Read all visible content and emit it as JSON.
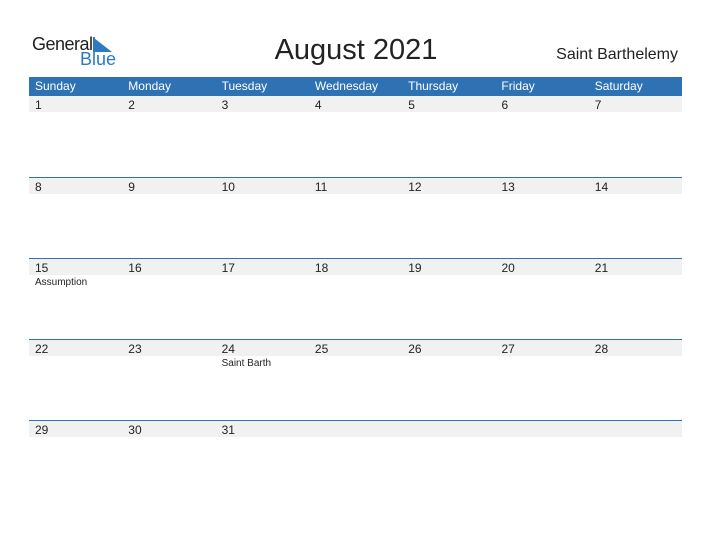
{
  "logo": {
    "general": "General",
    "blue": "Blue"
  },
  "title": "August 2021",
  "country": "Saint Barthelemy",
  "colors": {
    "accent": "#2e72b4",
    "band": "#f1f1f1"
  },
  "weekdays": [
    "Sunday",
    "Monday",
    "Tuesday",
    "Wednesday",
    "Thursday",
    "Friday",
    "Saturday"
  ],
  "weeks": [
    [
      {
        "day": "1"
      },
      {
        "day": "2"
      },
      {
        "day": "3"
      },
      {
        "day": "4"
      },
      {
        "day": "5"
      },
      {
        "day": "6"
      },
      {
        "day": "7"
      }
    ],
    [
      {
        "day": "8"
      },
      {
        "day": "9"
      },
      {
        "day": "10"
      },
      {
        "day": "11"
      },
      {
        "day": "12"
      },
      {
        "day": "13"
      },
      {
        "day": "14"
      }
    ],
    [
      {
        "day": "15",
        "holiday": "Assumption"
      },
      {
        "day": "16"
      },
      {
        "day": "17"
      },
      {
        "day": "18"
      },
      {
        "day": "19"
      },
      {
        "day": "20"
      },
      {
        "day": "21"
      }
    ],
    [
      {
        "day": "22"
      },
      {
        "day": "23"
      },
      {
        "day": "24",
        "holiday": "Saint Barth"
      },
      {
        "day": "25"
      },
      {
        "day": "26"
      },
      {
        "day": "27"
      },
      {
        "day": "28"
      }
    ],
    [
      {
        "day": "29"
      },
      {
        "day": "30"
      },
      {
        "day": "31"
      },
      {
        "day": ""
      },
      {
        "day": ""
      },
      {
        "day": ""
      },
      {
        "day": ""
      }
    ]
  ]
}
